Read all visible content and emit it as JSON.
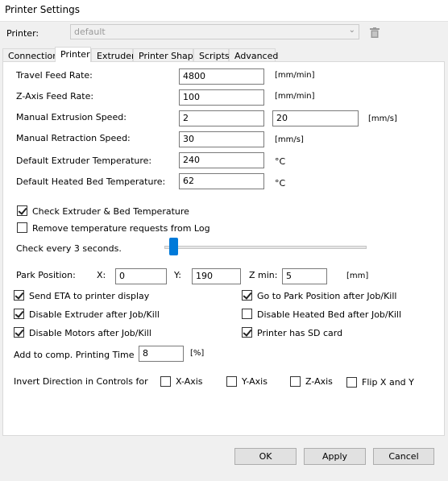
{
  "window": {
    "title": "Printer Settings"
  },
  "printer": {
    "label": "Printer:",
    "value": "default"
  },
  "tabs": [
    "Connection",
    "Printer",
    "Extruder",
    "Printer Shape",
    "Scripts",
    "Advanced"
  ],
  "rates": {
    "travel_label": "Travel Feed Rate:",
    "travel_value": "4800",
    "travel_unit": "[mm/min]",
    "zaxis_label": "Z-Axis Feed Rate:",
    "zaxis_value": "100",
    "zaxis_unit": "[mm/min]",
    "extrusion_label": "Manual Extrusion Speed:",
    "extrusion_value1": "2",
    "extrusion_value2": "20",
    "extrusion_unit": "[mm/s]",
    "retraction_label": "Manual Retraction Speed:",
    "retraction_value": "30",
    "retraction_unit": "[mm/s]",
    "extruder_temp_label": "Default Extruder Temperature:",
    "extruder_temp_value": "240",
    "extruder_temp_unit": "°C",
    "bed_temp_label": "Default Heated Bed Temperature:",
    "bed_temp_value": "62",
    "bed_temp_unit": "°C"
  },
  "checks": {
    "check_temp": "Check Extruder & Bed Temperature",
    "remove_temp": "Remove temperature requests from Log",
    "check_every": "Check every 3 seconds.",
    "check_every_slider_value": 3
  },
  "park": {
    "label": "Park Position:",
    "x_label": "X:",
    "x_value": "0",
    "y_label": "Y:",
    "y_value": "190",
    "zmin_label": "Z min:",
    "zmin_value": "5",
    "unit": "[mm]"
  },
  "options": {
    "send_eta": "Send ETA to printer display",
    "go_park": "Go to Park Position after Job/Kill",
    "disable_extruder": "Disable Extruder after Job/Kill",
    "disable_bed": "Disable Heated Bed after Job/Kill",
    "disable_motors": "Disable Motors after Job/Kill",
    "sd_card": "Printer has SD card"
  },
  "comp": {
    "label": "Add to comp. Printing Time",
    "value": "8",
    "unit": "[%]"
  },
  "invert": {
    "label": "Invert Direction in Controls for",
    "x": "X-Axis",
    "y": "Y-Axis",
    "z": "Z-Axis",
    "flip": "Flip X and Y"
  },
  "buttons": {
    "ok": "OK",
    "apply": "Apply",
    "cancel": "Cancel"
  }
}
